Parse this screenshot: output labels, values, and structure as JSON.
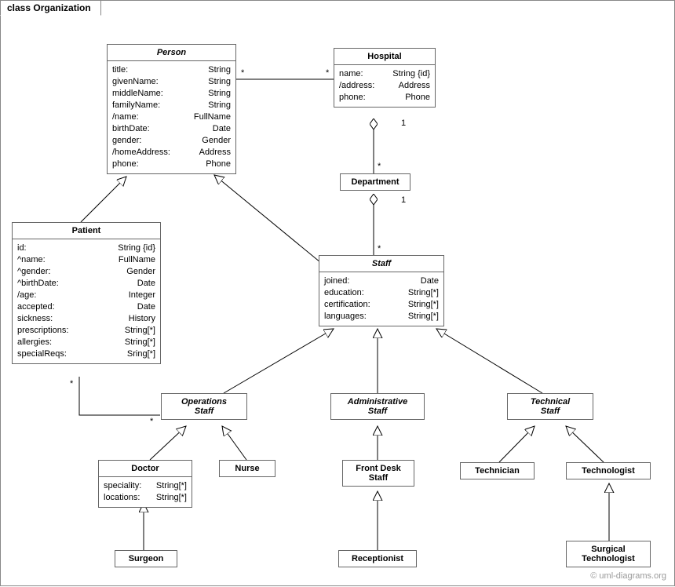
{
  "frame": {
    "title": "class Organization"
  },
  "watermark": "© uml-diagrams.org",
  "classes": {
    "person": {
      "name": "Person",
      "attrs": [
        {
          "n": "title:",
          "t": "String"
        },
        {
          "n": "givenName:",
          "t": "String"
        },
        {
          "n": "middleName:",
          "t": "String"
        },
        {
          "n": "familyName:",
          "t": "String"
        },
        {
          "n": "/name:",
          "t": "FullName"
        },
        {
          "n": "birthDate:",
          "t": "Date"
        },
        {
          "n": "gender:",
          "t": "Gender"
        },
        {
          "n": "/homeAddress:",
          "t": "Address"
        },
        {
          "n": "phone:",
          "t": "Phone"
        }
      ]
    },
    "hospital": {
      "name": "Hospital",
      "attrs": [
        {
          "n": "name:",
          "t": "String {id}"
        },
        {
          "n": "/address:",
          "t": "Address"
        },
        {
          "n": "phone:",
          "t": "Phone"
        }
      ]
    },
    "department": {
      "name": "Department"
    },
    "patient": {
      "name": "Patient",
      "attrs": [
        {
          "n": "id:",
          "t": "String {id}"
        },
        {
          "n": "^name:",
          "t": "FullName"
        },
        {
          "n": "^gender:",
          "t": "Gender"
        },
        {
          "n": "^birthDate:",
          "t": "Date"
        },
        {
          "n": "/age:",
          "t": "Integer"
        },
        {
          "n": "accepted:",
          "t": "Date"
        },
        {
          "n": "sickness:",
          "t": "History"
        },
        {
          "n": "prescriptions:",
          "t": "String[*]"
        },
        {
          "n": "allergies:",
          "t": "String[*]"
        },
        {
          "n": "specialReqs:",
          "t": "Sring[*]"
        }
      ]
    },
    "staff": {
      "name": "Staff",
      "attrs": [
        {
          "n": "joined:",
          "t": "Date"
        },
        {
          "n": "education:",
          "t": "String[*]"
        },
        {
          "n": "certification:",
          "t": "String[*]"
        },
        {
          "n": "languages:",
          "t": "String[*]"
        }
      ]
    },
    "opsStaff": {
      "name": "Operations",
      "name2": "Staff"
    },
    "adminStaff": {
      "name": "Administrative",
      "name2": "Staff"
    },
    "techStaff": {
      "name": "Technical",
      "name2": "Staff"
    },
    "doctor": {
      "name": "Doctor",
      "attrs": [
        {
          "n": "speciality:",
          "t": "String[*]"
        },
        {
          "n": "locations:",
          "t": "String[*]"
        }
      ]
    },
    "nurse": {
      "name": "Nurse"
    },
    "frontDesk": {
      "name": "Front Desk",
      "name2": "Staff"
    },
    "technician": {
      "name": "Technician"
    },
    "technologist": {
      "name": "Technologist"
    },
    "surgeon": {
      "name": "Surgeon"
    },
    "receptionist": {
      "name": "Receptionist"
    },
    "surgicalTech": {
      "name": "Surgical",
      "name2": "Technologist"
    }
  },
  "mult": {
    "personStar": "*",
    "hospitalStar": "*",
    "hospDept1": "1",
    "hospDeptStar": "*",
    "deptStaff1": "1",
    "deptStaffStar": "*",
    "patientStar": "*",
    "opsStar": "*"
  }
}
